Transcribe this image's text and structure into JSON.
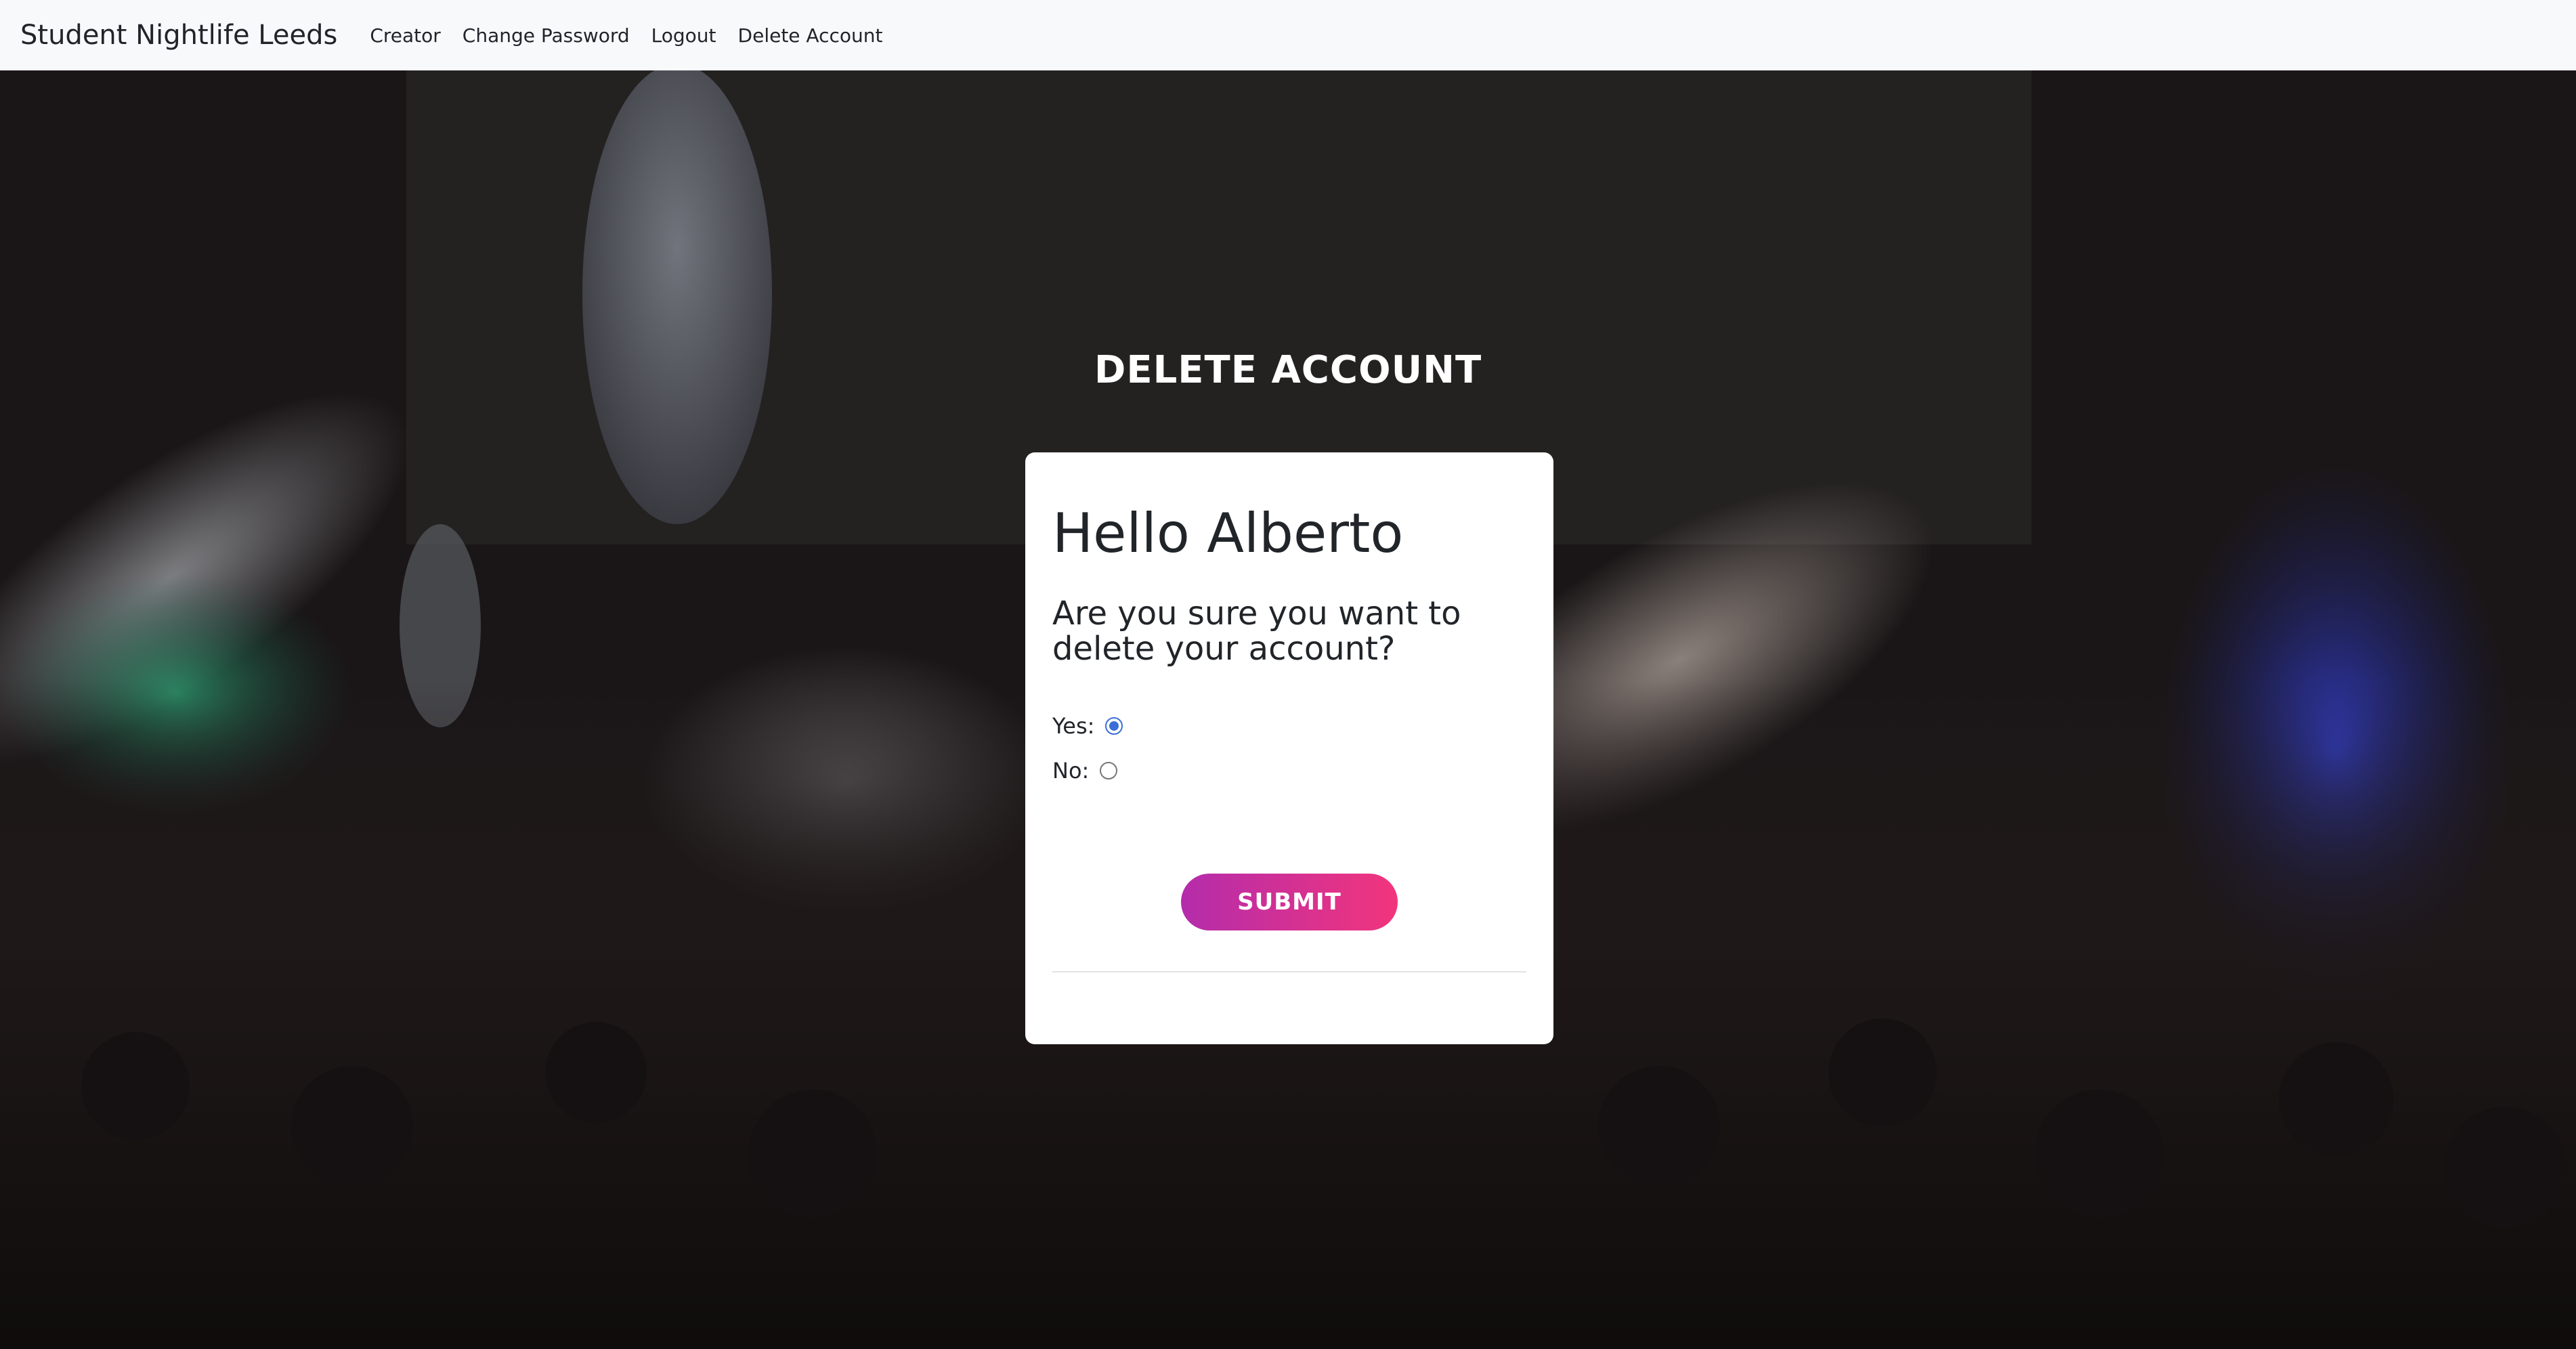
{
  "navbar": {
    "brand": "Student Nightlife Leeds",
    "links": [
      "Creator",
      "Change Password",
      "Logout",
      "Delete Account"
    ]
  },
  "page": {
    "heading": "DELETE ACCOUNT"
  },
  "card": {
    "greeting": "Hello Alberto",
    "question": "Are you sure you want to delete your account?",
    "options": [
      {
        "label": "Yes:",
        "checked": true
      },
      {
        "label": "No:",
        "checked": false
      }
    ],
    "submit_label": "SUBMIT"
  },
  "colors": {
    "navbar_bg": "#f8f9fa",
    "button_gradient_start": "#b42cab",
    "button_gradient_end": "#f2357c",
    "radio_selected": "#3b6fd6"
  }
}
